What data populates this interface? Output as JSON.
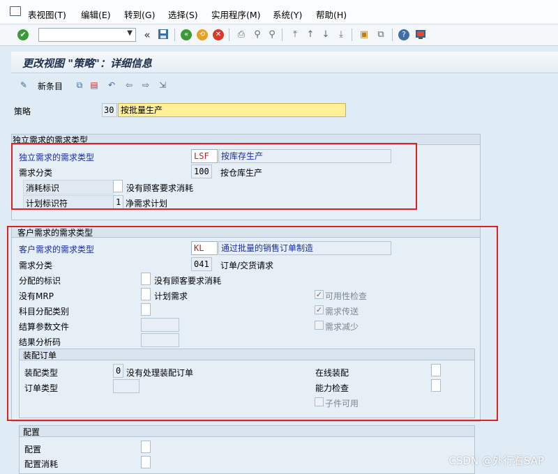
{
  "menubar": {
    "items": [
      "表视图(T)",
      "编辑(E)",
      "转到(G)",
      "选择(S)",
      "实用程序(M)",
      "系统(Y)",
      "帮助(H)"
    ]
  },
  "toolbar": {
    "back_label": "«"
  },
  "page": {
    "title": "更改视图 \"策略\"：详细信息"
  },
  "app_toolbar": {
    "new_entries_label": "新条目"
  },
  "strategy": {
    "label": "策略",
    "code": "30",
    "description": "按批量生产"
  },
  "independent": {
    "section_title": "独立需求的需求类型",
    "req_type_label": "独立需求的需求类型",
    "req_type_code": "LSF",
    "req_type_desc": "按库存生产",
    "req_class_label": "需求分类",
    "req_class_code": "100",
    "req_class_desc": "按仓库生产",
    "consumption_label": "消耗标识",
    "consumption_desc": "没有顾客要求消耗",
    "planning_label": "计划标识符",
    "planning_code": "1",
    "planning_desc": "净需求计划"
  },
  "customer": {
    "section_title": "客户需求的需求类型",
    "req_type_label": "客户需求的需求类型",
    "req_type_code": "KL",
    "req_type_desc": "通过批量的销售订单制造",
    "req_class_label": "需求分类",
    "req_class_code": "041",
    "req_class_desc": "订单/交货请求",
    "allocation_label": "分配的标识",
    "allocation_desc": "没有顾客要求消耗",
    "no_mrp_label": "没有MRP",
    "no_mrp_desc": "计划需求",
    "account_label": "科目分配类别",
    "settlement_label": "结算参数文件",
    "result_label": "结果分析码",
    "availability_label": "可用性检查",
    "transfer_label": "需求传送",
    "reduction_label": "需求减少"
  },
  "assembly": {
    "section_title": "装配订单",
    "type_label": "装配类型",
    "type_code": "0",
    "type_desc": "没有处理装配订单",
    "order_type_label": "订单类型",
    "online_label": "在线装配",
    "capacity_label": "能力检查",
    "component_label": "子件可用"
  },
  "config": {
    "section_title": "配置",
    "config_label": "配置",
    "consumption_label": "配置消耗"
  },
  "watermark": {
    "text": "CSDN @外行看SAP"
  },
  "colors": {
    "red_highlight": "#e02020",
    "link_blue": "#1a2fa0",
    "panel_bg": "#e6eef6"
  }
}
